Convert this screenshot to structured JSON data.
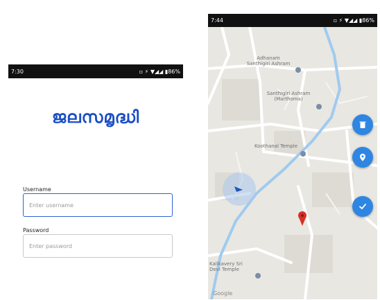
{
  "login": {
    "status_time": "7:30",
    "status_right": "▫ ⚡ ▼◢◢ ▮86%",
    "app_title": "ജലസമൃദ്ധി",
    "username_label": "Username",
    "username_placeholder": "Enter username",
    "password_label": "Password",
    "password_placeholder": "Enter password"
  },
  "map_screen": {
    "status_time": "7:44",
    "status_right": "▫ ⚡ ▼◢◢ ▮86%",
    "pois": [
      {
        "label": "Adhanam\nSanthigiri Ashram"
      },
      {
        "label": "Santhigiri Ashram\n(Marthoma)"
      },
      {
        "label": "Koothanal Temple"
      },
      {
        "label": "Kalikavery Sri\nDevi Temple"
      }
    ],
    "attribution": "Google",
    "colors": {
      "fab": "#2f86e2",
      "marker": "#d93025",
      "route": "#8ec3f2",
      "title": "#1a4ec5"
    }
  }
}
